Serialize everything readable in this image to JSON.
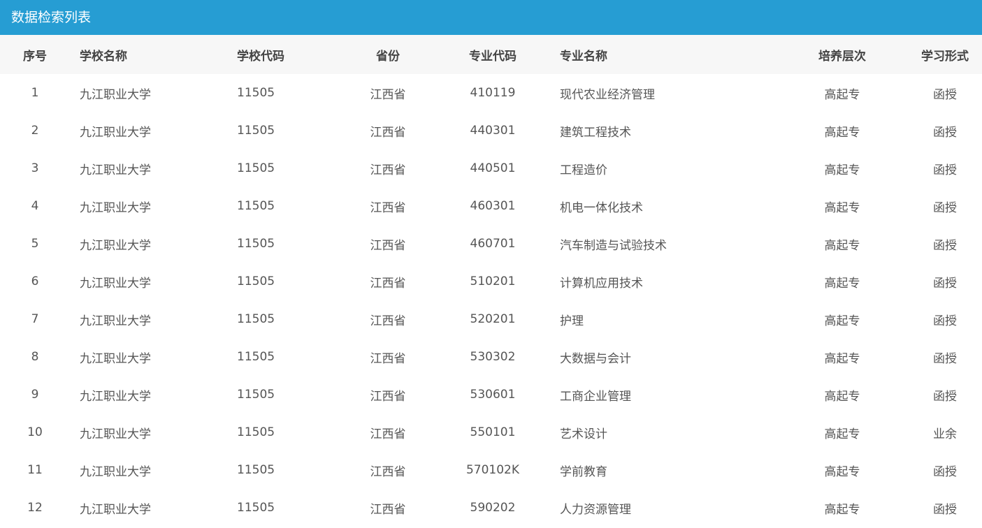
{
  "title": "数据检索列表",
  "colors": {
    "title_bar": "#269dd3",
    "header_bg": "#f7f7f7"
  },
  "columns": [
    "序号",
    "学校名称",
    "学校代码",
    "省份",
    "专业代码",
    "专业名称",
    "培养层次",
    "学习形式"
  ],
  "rows": [
    [
      "1",
      "九江职业大学",
      "11505",
      "江西省",
      "410119",
      "现代农业经济管理",
      "高起专",
      "函授"
    ],
    [
      "2",
      "九江职业大学",
      "11505",
      "江西省",
      "440301",
      "建筑工程技术",
      "高起专",
      "函授"
    ],
    [
      "3",
      "九江职业大学",
      "11505",
      "江西省",
      "440501",
      "工程造价",
      "高起专",
      "函授"
    ],
    [
      "4",
      "九江职业大学",
      "11505",
      "江西省",
      "460301",
      "机电一体化技术",
      "高起专",
      "函授"
    ],
    [
      "5",
      "九江职业大学",
      "11505",
      "江西省",
      "460701",
      "汽车制造与试验技术",
      "高起专",
      "函授"
    ],
    [
      "6",
      "九江职业大学",
      "11505",
      "江西省",
      "510201",
      "计算机应用技术",
      "高起专",
      "函授"
    ],
    [
      "7",
      "九江职业大学",
      "11505",
      "江西省",
      "520201",
      "护理",
      "高起专",
      "函授"
    ],
    [
      "8",
      "九江职业大学",
      "11505",
      "江西省",
      "530302",
      "大数据与会计",
      "高起专",
      "函授"
    ],
    [
      "9",
      "九江职业大学",
      "11505",
      "江西省",
      "530601",
      "工商企业管理",
      "高起专",
      "函授"
    ],
    [
      "10",
      "九江职业大学",
      "11505",
      "江西省",
      "550101",
      "艺术设计",
      "高起专",
      "业余"
    ],
    [
      "11",
      "九江职业大学",
      "11505",
      "江西省",
      "570102K",
      "学前教育",
      "高起专",
      "函授"
    ],
    [
      "12",
      "九江职业大学",
      "11505",
      "江西省",
      "590202",
      "人力资源管理",
      "高起专",
      "函授"
    ]
  ]
}
